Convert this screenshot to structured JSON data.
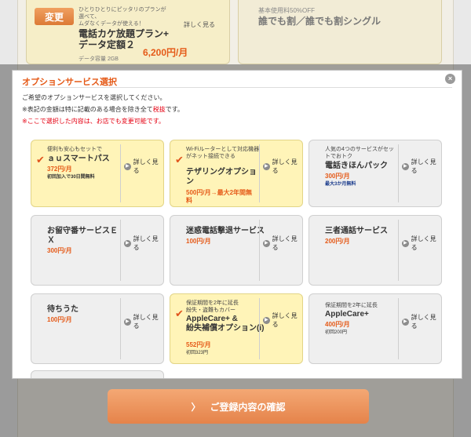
{
  "background": {
    "change_label": "変更",
    "left_small": "ひとりひとりにピッタリのプランが\n選べて、\nムダなくデータが使える！",
    "left_plan": "電話カケ放題プラン+\nデータ定額２",
    "left_price": "6,200円/月",
    "left_caption": "データ容量 2GB",
    "left_detail": "詳しく見る",
    "right_sub": "基本使用料50%OFF",
    "right_title": "誰でも割／誰でも割シングル"
  },
  "modal": {
    "title": "オプションサービス選択",
    "close": "×",
    "line1": "ご希望のオプションサービスを選択してください。",
    "line2_pre": "※表記の金額は特に記載のある場合を除き全て",
    "line2_tax": "税抜",
    "line2_post": "です。",
    "line3": "※ここで選択した内容は、お店でも変更可能です。"
  },
  "check_mark": "✔",
  "detail_arrow": "▶",
  "cards": [
    {
      "selected": true,
      "sub": "便利も安心もセットで",
      "title": "ａｕスマートパス",
      "price": "372円/月",
      "note": "初回加入で30日間無料",
      "detail": "詳しく見る"
    },
    {
      "selected": true,
      "sub": "Wi-Fiルーターとして対応機器がネット接続できる",
      "title": "テザリングオプション",
      "price": "500円/月→最大2年間無料",
      "note": "",
      "detail": "詳しく見る"
    },
    {
      "selected": false,
      "sub": "人気の4つのサービスがセットでおトク",
      "title": "電話きほんパック",
      "price": "300円/月",
      "note": "最大3か月無料",
      "detail": "詳しく見る"
    },
    {
      "selected": false,
      "sub": "",
      "title": "お留守番サービスＥＸ",
      "price": "300円/月",
      "note": "",
      "detail": "詳しく見る"
    },
    {
      "selected": false,
      "sub": "",
      "title": "迷惑電話撃退サービス",
      "price": "100円/月",
      "note": "",
      "detail": "詳しく見る"
    },
    {
      "selected": false,
      "sub": "",
      "title": "三者通話サービス",
      "price": "200円/月",
      "note": "",
      "detail": "詳しく見る"
    },
    {
      "selected": false,
      "sub": "",
      "title": "待ちうた",
      "price": "100円/月",
      "note": "",
      "detail": "詳しく見る"
    },
    {
      "selected": true,
      "sub": "保証期間を2年に延長\n紛失・盗難もカバー",
      "title": "AppleCare+ &\n紛失補償オプション(i)",
      "price": "552円/月",
      "note": "初回323円",
      "detail": "詳しく見る"
    },
    {
      "selected": false,
      "sub": "保証期間を2年に延長",
      "title": "AppleCare+",
      "price": "400円/月",
      "note": "初回200円",
      "detail": "詳しく見る"
    }
  ],
  "confirm": {
    "chevron": "〉",
    "label": "ご登録内容の確認"
  }
}
